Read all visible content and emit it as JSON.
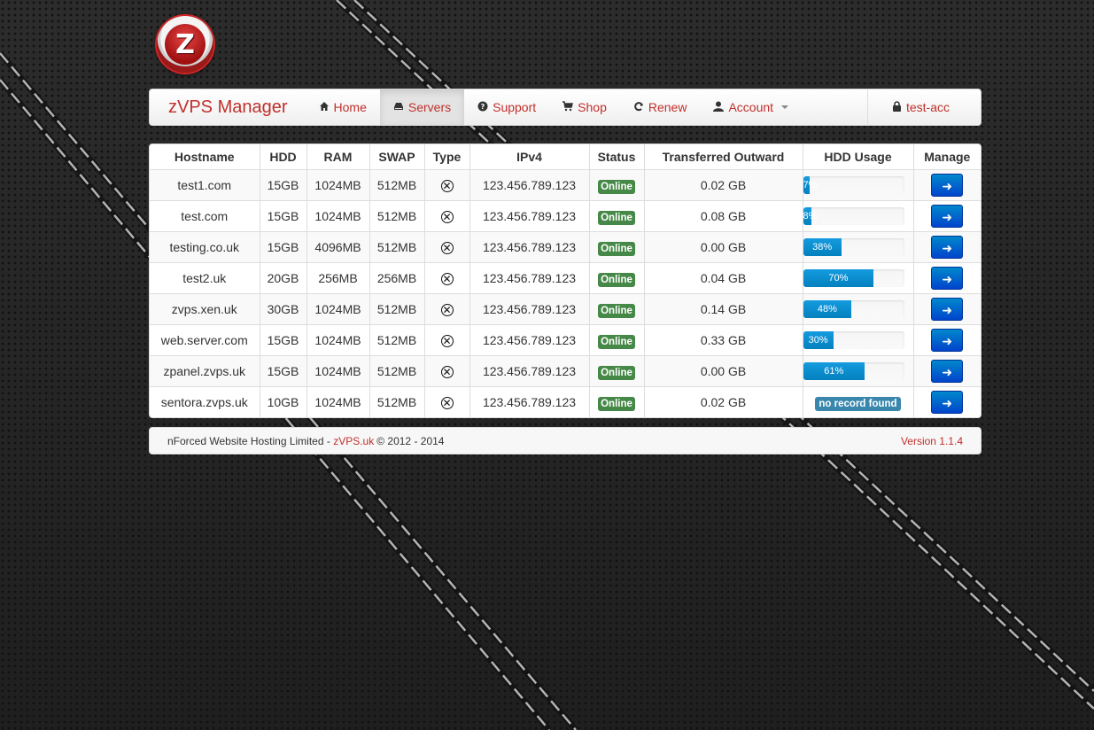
{
  "logo": {
    "letter": "Z"
  },
  "navbar": {
    "brand": "zVPS Manager",
    "items": [
      {
        "label": "Home",
        "icon": "home-icon"
      },
      {
        "label": "Servers",
        "icon": "hdd-icon",
        "active": true
      },
      {
        "label": "Support",
        "icon": "question-icon"
      },
      {
        "label": "Shop",
        "icon": "cart-icon"
      },
      {
        "label": "Renew",
        "icon": "refresh-icon"
      },
      {
        "label": "Account",
        "icon": "user-icon"
      }
    ],
    "user": "test-acc"
  },
  "table": {
    "headers": [
      "Hostname",
      "HDD",
      "RAM",
      "SWAP",
      "Type",
      "IPv4",
      "Status",
      "Transferred Outward",
      "HDD Usage",
      "Manage"
    ],
    "rows": [
      {
        "hostname": "test1.com",
        "hdd": "15GB",
        "ram": "1024MB",
        "swap": "512MB",
        "ipv4": "123.456.789.123",
        "status": "Online",
        "transferred": "0.02 GB",
        "usage": 7
      },
      {
        "hostname": "test.com",
        "hdd": "15GB",
        "ram": "1024MB",
        "swap": "512MB",
        "ipv4": "123.456.789.123",
        "status": "Online",
        "transferred": "0.08 GB",
        "usage": 8
      },
      {
        "hostname": "testing.co.uk",
        "hdd": "15GB",
        "ram": "4096MB",
        "swap": "512MB",
        "ipv4": "123.456.789.123",
        "status": "Online",
        "transferred": "0.00 GB",
        "usage": 38
      },
      {
        "hostname": "test2.uk",
        "hdd": "20GB",
        "ram": "256MB",
        "swap": "256MB",
        "ipv4": "123.456.789.123",
        "status": "Online",
        "transferred": "0.04 GB",
        "usage": 70
      },
      {
        "hostname": "zvps.xen.uk",
        "hdd": "30GB",
        "ram": "1024MB",
        "swap": "512MB",
        "ipv4": "123.456.789.123",
        "status": "Online",
        "transferred": "0.14 GB",
        "usage": 48
      },
      {
        "hostname": "web.server.com",
        "hdd": "15GB",
        "ram": "1024MB",
        "swap": "512MB",
        "ipv4": "123.456.789.123",
        "status": "Online",
        "transferred": "0.33 GB",
        "usage": 30
      },
      {
        "hostname": "zpanel.zvps.uk",
        "hdd": "15GB",
        "ram": "1024MB",
        "swap": "512MB",
        "ipv4": "123.456.789.123",
        "status": "Online",
        "transferred": "0.00 GB",
        "usage": 61
      },
      {
        "hostname": "sentora.zvps.uk",
        "hdd": "10GB",
        "ram": "1024MB",
        "swap": "512MB",
        "ipv4": "123.456.789.123",
        "status": "Online",
        "transferred": "0.02 GB",
        "usage": null,
        "usage_text": "no record found"
      }
    ]
  },
  "footer": {
    "company": "nForced Website Hosting Limited - ",
    "link": "zVPS.uk",
    "copyright": "© 2012 - 2014",
    "version": "Version 1.1.4"
  }
}
